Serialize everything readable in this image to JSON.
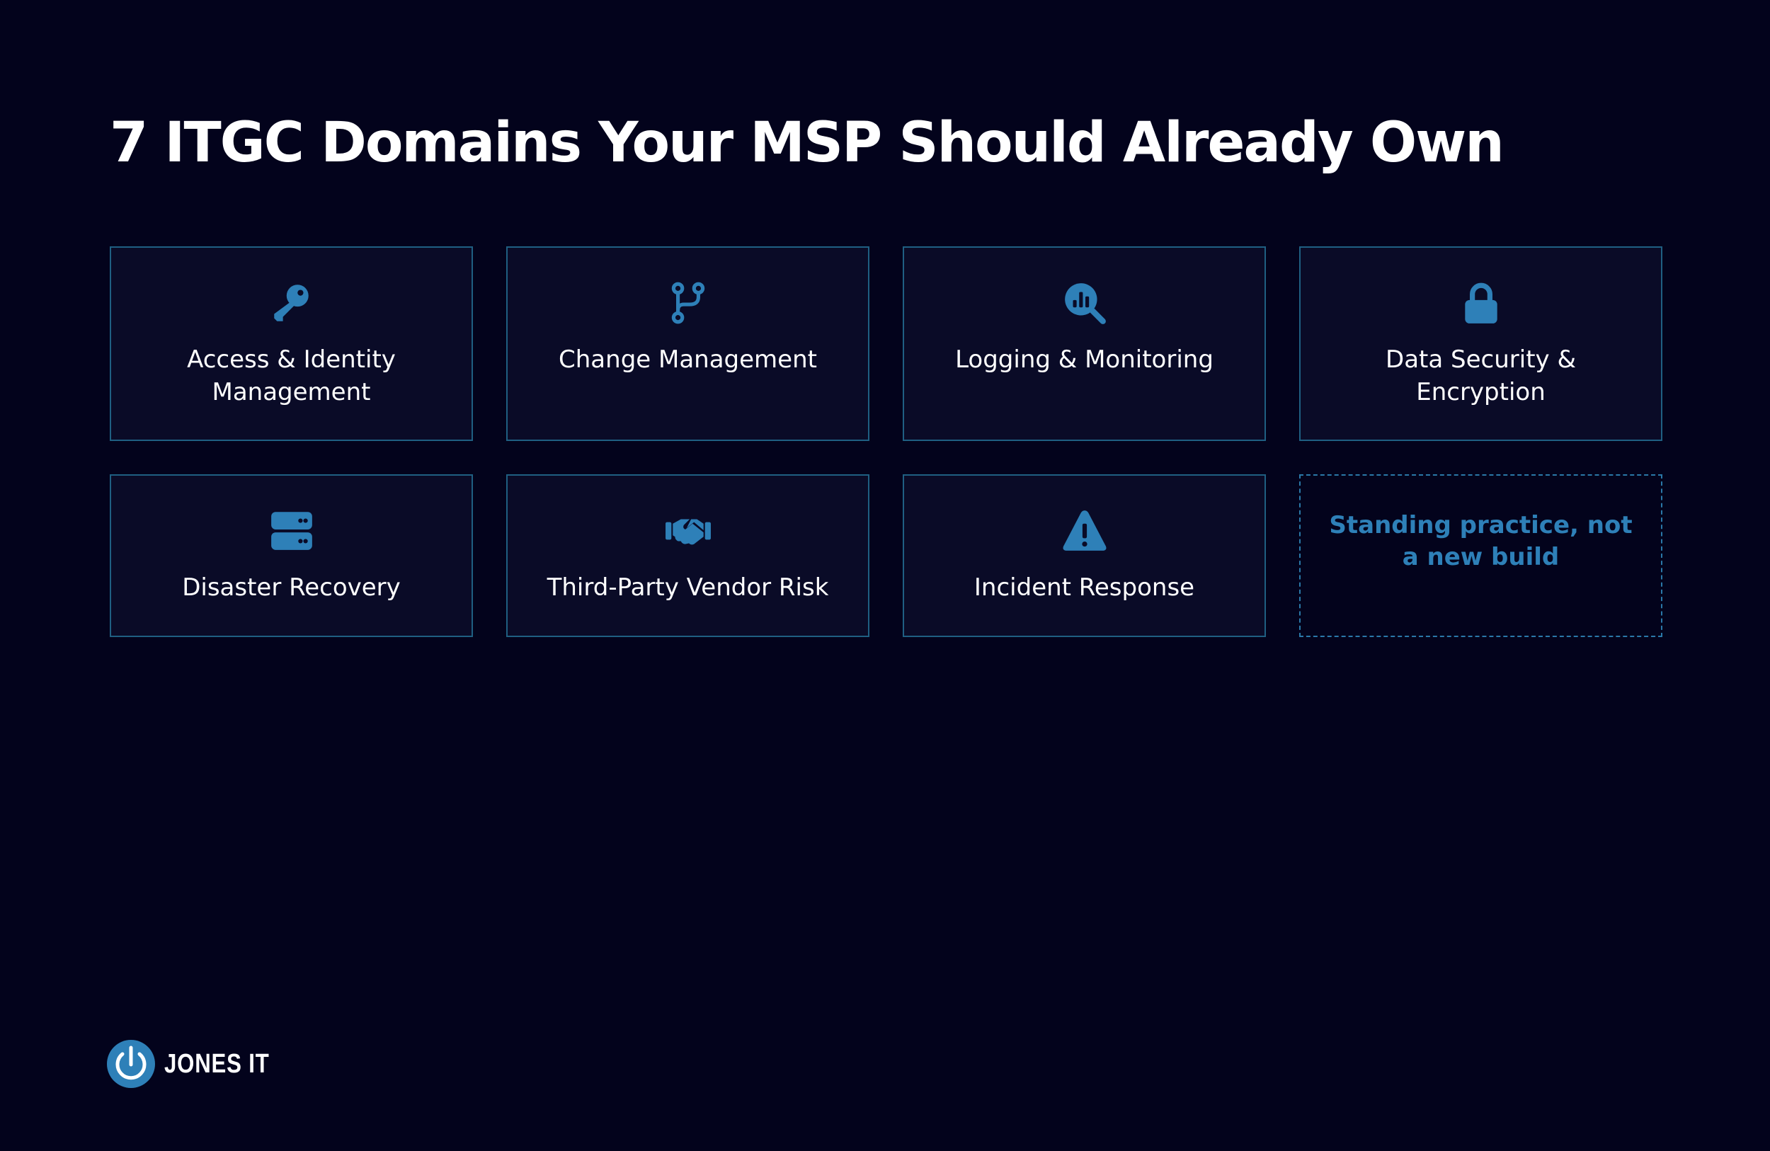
{
  "title": "7 ITGC Domains Your MSP Should Already Own",
  "colors": {
    "background": "#03031c",
    "card_background": "#0a0b27",
    "card_border": "#1f5f82",
    "accent": "#2e80b8",
    "text": "#ffffff"
  },
  "domains": [
    {
      "label": "Access & Identity Management",
      "icon": "key-icon"
    },
    {
      "label": "Change Management",
      "icon": "code-branch-icon"
    },
    {
      "label": "Logging & Monitoring",
      "icon": "magnifying-glass-chart-icon"
    },
    {
      "label": "Data Security & Encryption",
      "icon": "lock-icon"
    },
    {
      "label": "Disaster Recovery",
      "icon": "server-icon"
    },
    {
      "label": "Third-Party Vendor Risk",
      "icon": "handshake-icon"
    },
    {
      "label": "Incident Response",
      "icon": "warning-triangle-icon"
    }
  ],
  "note": "Standing practice, not a new build",
  "brand": {
    "name": "JONES IT",
    "logo_icon": "power-icon"
  }
}
